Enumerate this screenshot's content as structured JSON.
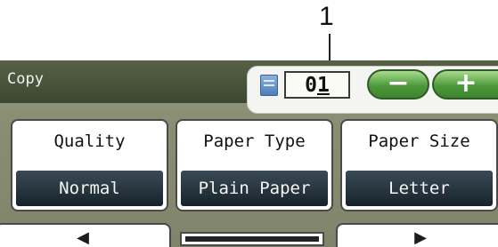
{
  "callout": {
    "number": "1"
  },
  "header": {
    "mode": "Copy"
  },
  "copies": {
    "count_prefix": "0",
    "count_underlined": "1"
  },
  "controls": {
    "minus": "−",
    "plus": "+"
  },
  "settings": [
    {
      "name": "Quality",
      "value": "Normal"
    },
    {
      "name": "Paper Type",
      "value": "Plain Paper"
    },
    {
      "name": "Paper Size",
      "value": "Letter"
    }
  ],
  "nav": {
    "left_arrow": "◀",
    "right_arrow": "▶"
  },
  "scrollbar": {
    "position_fraction": 0.25
  },
  "icons": {
    "document": "document-icon"
  },
  "colors": {
    "header": "#4a5540",
    "accent_green": "#4d9a3b",
    "value_bg": "#1f2c34"
  }
}
